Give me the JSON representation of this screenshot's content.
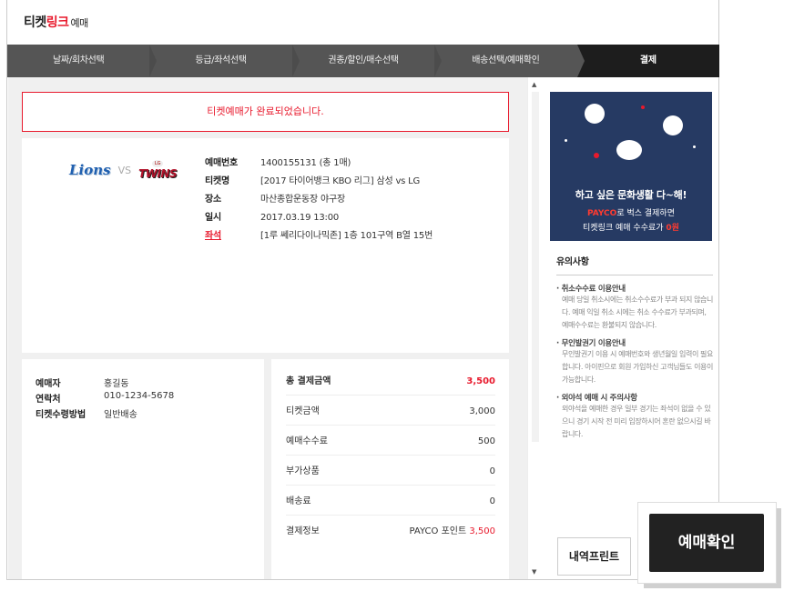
{
  "logo": {
    "part1": "티켓",
    "part2": "링크",
    "part3": "예매"
  },
  "steps": [
    "날짜/회차선택",
    "등급/좌석선택",
    "권종/할인/매수선택",
    "배송선택/예매확인",
    "결제"
  ],
  "alert_text": "티켓예매가 완료되었습니다.",
  "teams": {
    "home": "Lions",
    "vs": "VS",
    "away": "TWINS",
    "away_small": "LG"
  },
  "ticket": {
    "rows": [
      {
        "label": "예매번호",
        "value": "1400155131 (총 1매)"
      },
      {
        "label": "티켓명",
        "value": "[2017 타이어뱅크 KBO 리그] 삼성 vs LG"
      },
      {
        "label": "장소",
        "value": "마산종합운동장 야구장"
      },
      {
        "label": "일시",
        "value": "2017.03.19 13:00"
      },
      {
        "label": "좌석",
        "value": "[1루 쎄리다이나믹존] 1층 101구역 B열 15번"
      }
    ]
  },
  "buyer": {
    "rows": [
      {
        "label": "예매자",
        "value": "홍길동"
      },
      {
        "label": "연락처",
        "value": "010-1234-5678"
      },
      {
        "label": "티켓수령방법",
        "value": "일반배송"
      }
    ]
  },
  "payment": {
    "total_label": "총 결제금액",
    "total_value": "3,500",
    "rows": [
      {
        "label": "티켓금액",
        "value": "3,000"
      },
      {
        "label": "예매수수료",
        "value": "500"
      },
      {
        "label": "부가상품",
        "value": "0"
      },
      {
        "label": "배송료",
        "value": "0"
      }
    ],
    "method_label": "결제정보",
    "method_name": "PAYCO 포인트",
    "method_amount": "3,500"
  },
  "banner": {
    "line1": "하고 싶은 문화생활 다~해!",
    "line2_brand": "PAYCO",
    "line2_rest": "로 벅스 결제하면",
    "line3_prefix": "티켓링크 예매 수수료가 ",
    "line3_highlight": "0원"
  },
  "notes": {
    "title": "유의사항",
    "items": [
      {
        "title": "· 취소수수료 이용안내",
        "desc": "예매 당일 취소시에는 취소수수료가 부과 되지 않습니다. 예매 익일 취소 시에는 취소 수수료가 부과되며, 예매수수료는 환불되지 않습니다."
      },
      {
        "title": "· 무인발권기 이용안내",
        "desc": "무인발권기 이용 시 예매번호와 생년월일 입력이 필요합니다. 아이핀으로 회원 가입하신 고객님들도 이용이 가능합니다."
      },
      {
        "title": "· 외야석 예매 시 주의사항",
        "desc": "외야석을 예매한 경우 일부 경기는 좌석이 없을 수 있으니 경기 시작 전 미리 입장하시어 혼란 없으시길 바랍니다."
      }
    ]
  },
  "buttons": {
    "print": "내역프린트",
    "confirm": "예매확인"
  },
  "colors": {
    "accent": "#e8192c",
    "step_bg": "#555555",
    "step_active": "#1d1d1d",
    "banner_bg": "#263a63"
  }
}
